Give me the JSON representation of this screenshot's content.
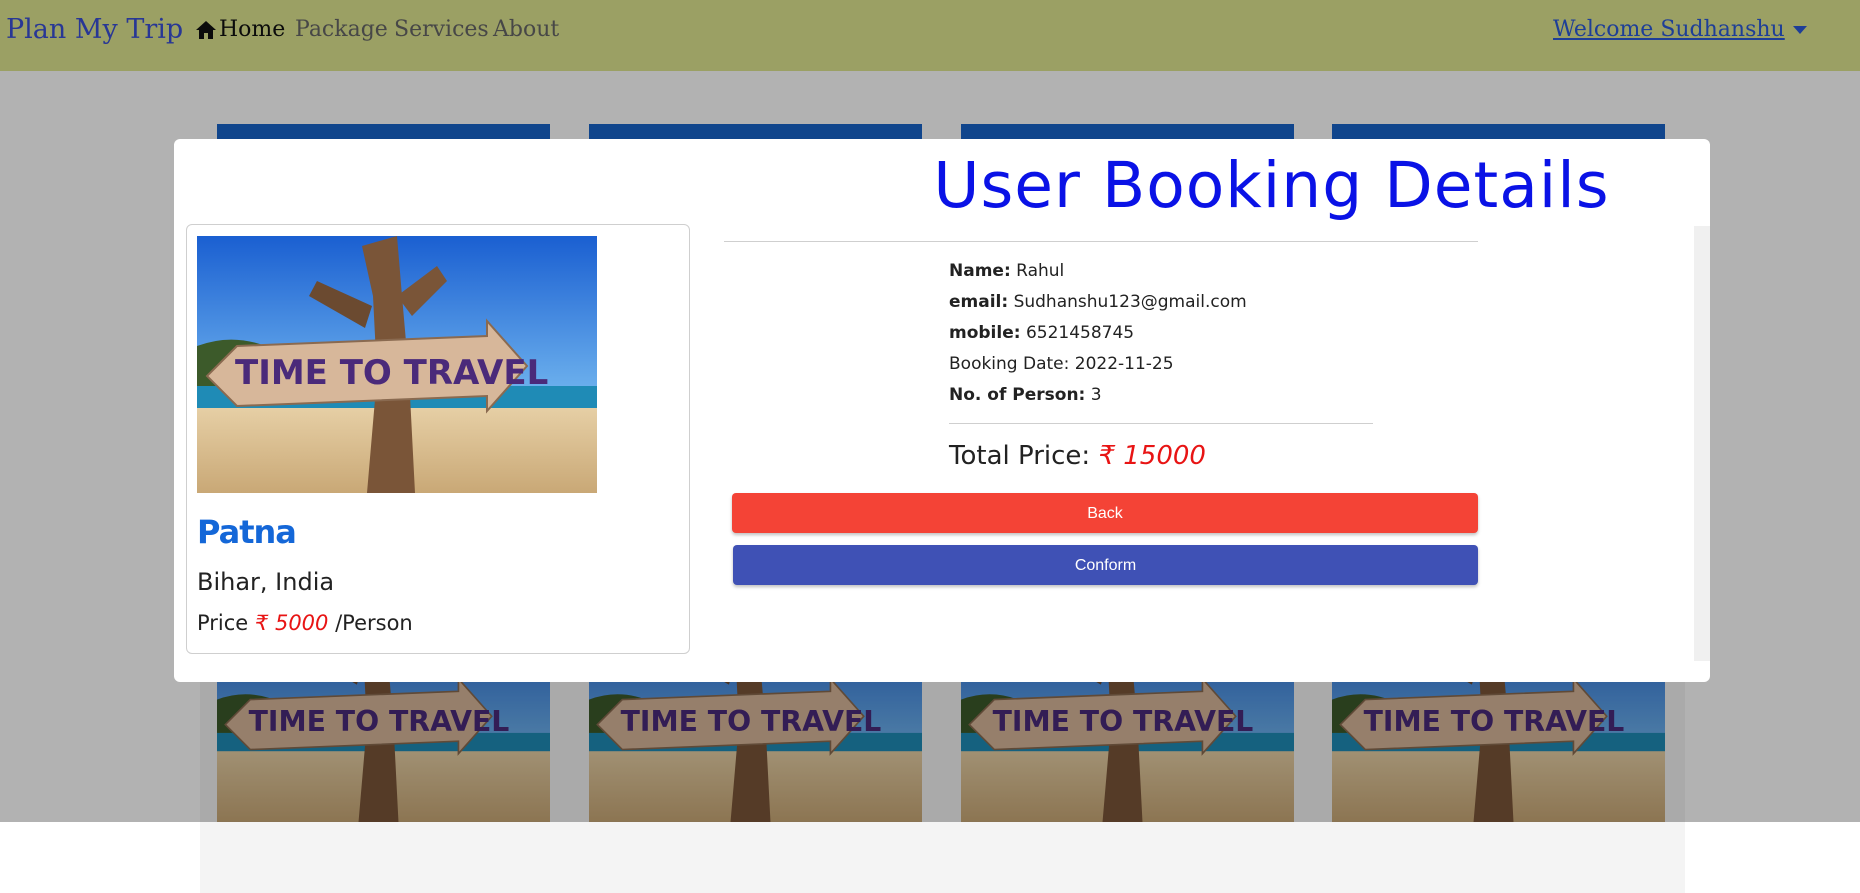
{
  "navbar": {
    "brand": "Plan My Trip",
    "links": [
      "Home",
      "Package",
      "Services",
      "About"
    ],
    "welcome": "Welcome Sudhanshu"
  },
  "background_cards": {
    "sign_text": "TIME TO TRAVEL"
  },
  "modal": {
    "title": "User Booking Details",
    "place": {
      "image_text": "TIME TO TRAVEL",
      "name": "Patna",
      "location": "Bihar, India",
      "price_label": "Price",
      "price_value": "₹ 5000",
      "price_unit": "/Person"
    },
    "details": {
      "name_label": "Name:",
      "name_value": "Rahul",
      "email_label": "email:",
      "email_value": "Sudhanshu123@gmail.com",
      "mobile_label": "mobile:",
      "mobile_value": "6521458745",
      "booking_date": "Booking Date: 2022-11-25",
      "persons_label": "No. of Person:",
      "persons_value": "3"
    },
    "total_label": "Total Price:",
    "total_value": "₹ 15000",
    "back_label": "Back",
    "conform_label": "Conform"
  },
  "colors": {
    "navbar_bg": "#dee690",
    "title_blue": "#0a12e6",
    "back_button": "#f44336",
    "conform_button": "#3f51b5",
    "price_red": "#e81414",
    "place_name_blue": "#1467d8"
  }
}
